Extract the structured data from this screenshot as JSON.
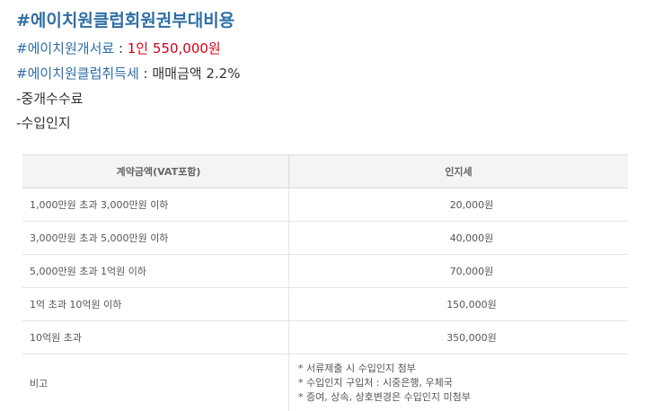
{
  "heading": "#에이치원클럽회원권부대비용",
  "fee_line": {
    "tag": "#에이치원개서료",
    "sep": " : ",
    "value": "1인 550,000원"
  },
  "tax_line": {
    "tag": "#에이치원클럽취득세",
    "sep": " : ",
    "value": "매매금액 2.2%"
  },
  "item_brokerage": "-중개수수료",
  "item_stamp": "-수입인지",
  "table": {
    "headers": [
      "계약금액(VAT포함)",
      "인지세"
    ],
    "rows": [
      [
        "1,000만원 초과 3,000만원 이하",
        "20,000원"
      ],
      [
        "3,000만원 초과 5,000만원 이하",
        "40,000원"
      ],
      [
        "5,000만원 초과 1억원 이하",
        "70,000원"
      ],
      [
        "1억 초과 10억원 이하",
        "150,000원"
      ],
      [
        "10억원 초과",
        "350,000원"
      ]
    ],
    "note_label": "비고",
    "notes": [
      "* 서류제출 시 수입인지 첨부",
      "* 수입인지 구입처 : 시중은행, 우체국",
      "* 증여, 상속, 상호변경은 수입인지 미첨부"
    ]
  }
}
